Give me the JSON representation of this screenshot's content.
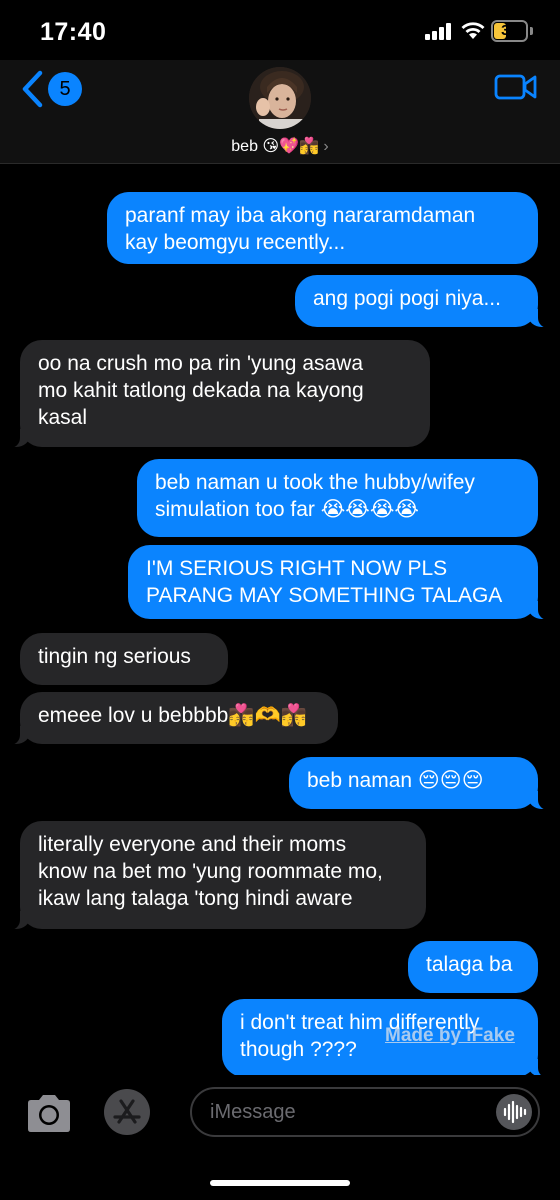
{
  "status_bar": {
    "time": "17:40",
    "battery": "37"
  },
  "header": {
    "back_count": "5",
    "contact_name": "beb 😘💖👩‍❤️‍💋‍👨",
    "chevron": "›"
  },
  "messages": [
    {
      "direction": "out",
      "text": "paranf may iba akong nararamdaman\nkay beomgyu recently..."
    },
    {
      "direction": "out",
      "text": "ang pogi pogi niya..."
    },
    {
      "direction": "in",
      "text": "oo na crush mo pa rin 'yung asawa\nmo kahit tatlong dekada na kayong\nkasal"
    },
    {
      "direction": "out",
      "text": "beb naman u took the hubby/wifey\nsimulation too far 😭😭😭😭"
    },
    {
      "direction": "out",
      "text": "I'M SERIOUS RIGHT NOW PLS\nPARANG MAY SOMETHING TALAGA"
    },
    {
      "direction": "in",
      "text": "tingin ng serious"
    },
    {
      "direction": "in",
      "text": "emeee lov u bebbbb👩‍❤️‍💋‍👨🫶👩‍❤️‍💋‍👨"
    },
    {
      "direction": "out",
      "text": "beb naman 😔😔😔"
    },
    {
      "direction": "in",
      "text": "literally everyone and their moms\nknow na bet mo 'yung roommate mo,\nikaw lang talaga 'tong hindi aware"
    },
    {
      "direction": "out",
      "text": "talaga ba"
    },
    {
      "direction": "out",
      "text": "i don't treat him differently\nthough ????"
    }
  ],
  "watermark": "Made by iFake",
  "input": {
    "placeholder": "iMessage"
  },
  "icons": {
    "back": "chevron-left-icon",
    "video": "video-camera-icon",
    "camera": "camera-icon",
    "apps": "app-store-icon",
    "audio": "waveform-icon"
  },
  "colors": {
    "accent": "#0a84ff",
    "outgoing_bubble": "#0b84fe",
    "incoming_bubble": "#262628",
    "battery": "#f6c43a"
  }
}
